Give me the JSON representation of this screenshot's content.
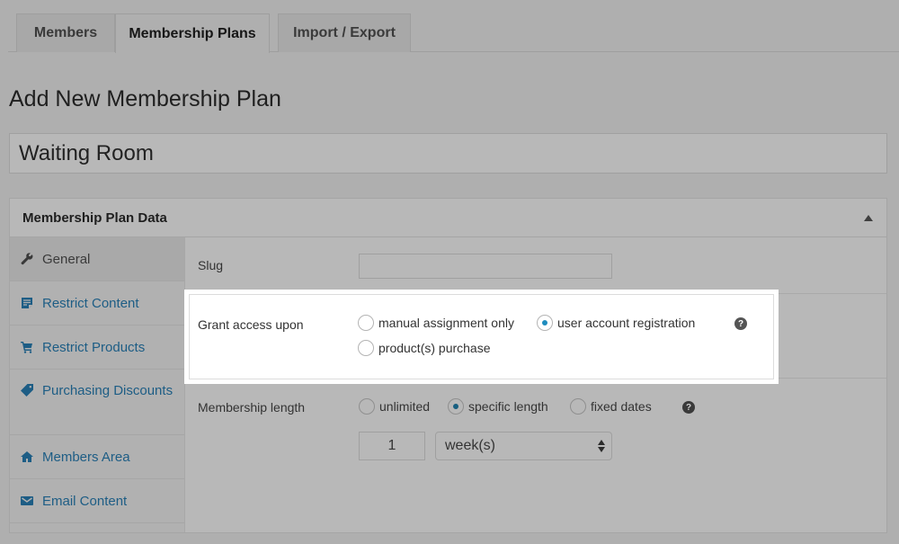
{
  "tabs": [
    {
      "label": "Members",
      "active": false
    },
    {
      "label": "Membership Plans",
      "active": true
    },
    {
      "label": "Import / Export",
      "active": false
    }
  ],
  "page_title": "Add New Membership Plan",
  "plan_name": {
    "value": "Waiting Room"
  },
  "panel": {
    "title": "Membership Plan Data",
    "toggle_icon": "triangle-up-icon",
    "sidebar": [
      {
        "label": "General",
        "icon": "wrench-icon",
        "active": true
      },
      {
        "label": "Restrict Content",
        "icon": "document-icon",
        "active": false
      },
      {
        "label": "Restrict Products",
        "icon": "cart-icon",
        "active": false
      },
      {
        "label": "Purchasing Discounts",
        "icon": "tag-icon",
        "active": false
      },
      {
        "label": "Members Area",
        "icon": "home-icon",
        "active": false
      },
      {
        "label": "Email Content",
        "icon": "envelope-icon",
        "active": false
      }
    ],
    "slug": {
      "label": "Slug",
      "value": ""
    },
    "grant_access": {
      "label": "Grant access upon",
      "options": [
        {
          "label": "manual assignment only",
          "checked": false
        },
        {
          "label": "user account registration",
          "checked": true
        },
        {
          "label": "product(s) purchase",
          "checked": false
        }
      ],
      "help": "?"
    },
    "membership_length": {
      "label": "Membership length",
      "options": [
        {
          "label": "unlimited",
          "checked": false
        },
        {
          "label": "specific length",
          "checked": true
        },
        {
          "label": "fixed dates",
          "checked": false
        }
      ],
      "help": "?",
      "length_value": "1",
      "period_selected": "week(s)"
    }
  },
  "colors": {
    "accent": "#1e8cbe",
    "link": "#1d5d85",
    "overlay_bg": "#afafaf",
    "highlight_bg": "#ffffff"
  }
}
